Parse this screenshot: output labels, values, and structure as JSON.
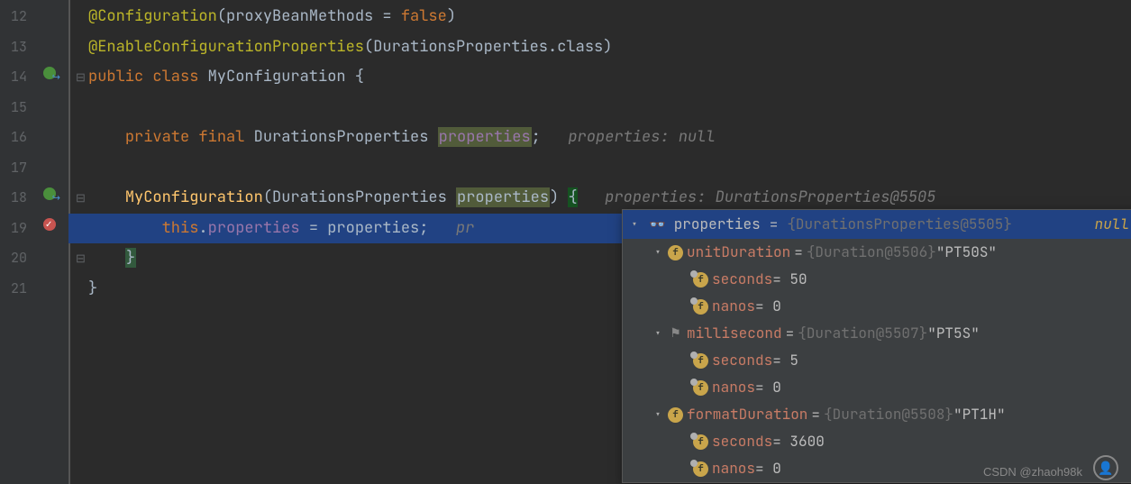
{
  "lines": [
    "12",
    "13",
    "14",
    "15",
    "16",
    "17",
    "18",
    "19",
    "20",
    "21"
  ],
  "code": {
    "l12": {
      "anno": "@Configuration",
      "arg1": "proxyBeanMethods",
      "eq": " = ",
      "val": "false"
    },
    "l13": {
      "anno": "@EnableConfigurationProperties",
      "arg": "DurationsProperties",
      "suffix": ".class"
    },
    "l14": {
      "kw1": "public",
      "kw2": "class",
      "name": "MyConfiguration",
      "brace": " {"
    },
    "l16": {
      "kw1": "private",
      "kw2": "final",
      "type": "DurationsProperties",
      "field": "properties",
      "semi": ";",
      "hint": "properties: null"
    },
    "l18": {
      "method": "MyConfiguration",
      "type": "DurationsProperties",
      "param": "properties",
      "brace": " {",
      "hint": "properties: DurationsProperties@5505"
    },
    "l19": {
      "kw": "this",
      "dot": ".",
      "field": "properties",
      "eq": " = ",
      "rhs": "properties",
      "semi": ";",
      "hint": "pr"
    },
    "l20": {
      "brace": "}"
    },
    "l21": {
      "brace": "}"
    }
  },
  "popup": {
    "header": {
      "name": "properties",
      "eq": " = ",
      "type": "{DurationsProperties@5505}"
    },
    "null": "null",
    "rows": [
      {
        "indent": 28,
        "chev": true,
        "icon": "f",
        "name": "unitDuration",
        "type": "{Duration@5506}",
        "val": "\"PT50S\""
      },
      {
        "indent": 56,
        "icon": "f",
        "gold": true,
        "name": "seconds",
        "valplain": " = 50"
      },
      {
        "indent": 56,
        "icon": "f",
        "gold": true,
        "name": "nanos",
        "valplain": " = 0"
      },
      {
        "indent": 28,
        "chev": true,
        "icon": "flag",
        "name": "millisecond",
        "type": "{Duration@5507}",
        "val": "\"PT5S\""
      },
      {
        "indent": 56,
        "icon": "f",
        "gold": true,
        "name": "seconds",
        "valplain": " = 5"
      },
      {
        "indent": 56,
        "icon": "f",
        "gold": true,
        "name": "nanos",
        "valplain": " = 0"
      },
      {
        "indent": 28,
        "chev": true,
        "icon": "f",
        "name": "formatDuration",
        "type": "{Duration@5508}",
        "val": "\"PT1H\""
      },
      {
        "indent": 56,
        "icon": "f",
        "gold": true,
        "name": "seconds",
        "valplain": " = 3600"
      },
      {
        "indent": 56,
        "icon": "f",
        "gold": true,
        "name": "nanos",
        "valplain": " = 0"
      }
    ]
  },
  "watermark": "CSDN @zhaoh98k"
}
